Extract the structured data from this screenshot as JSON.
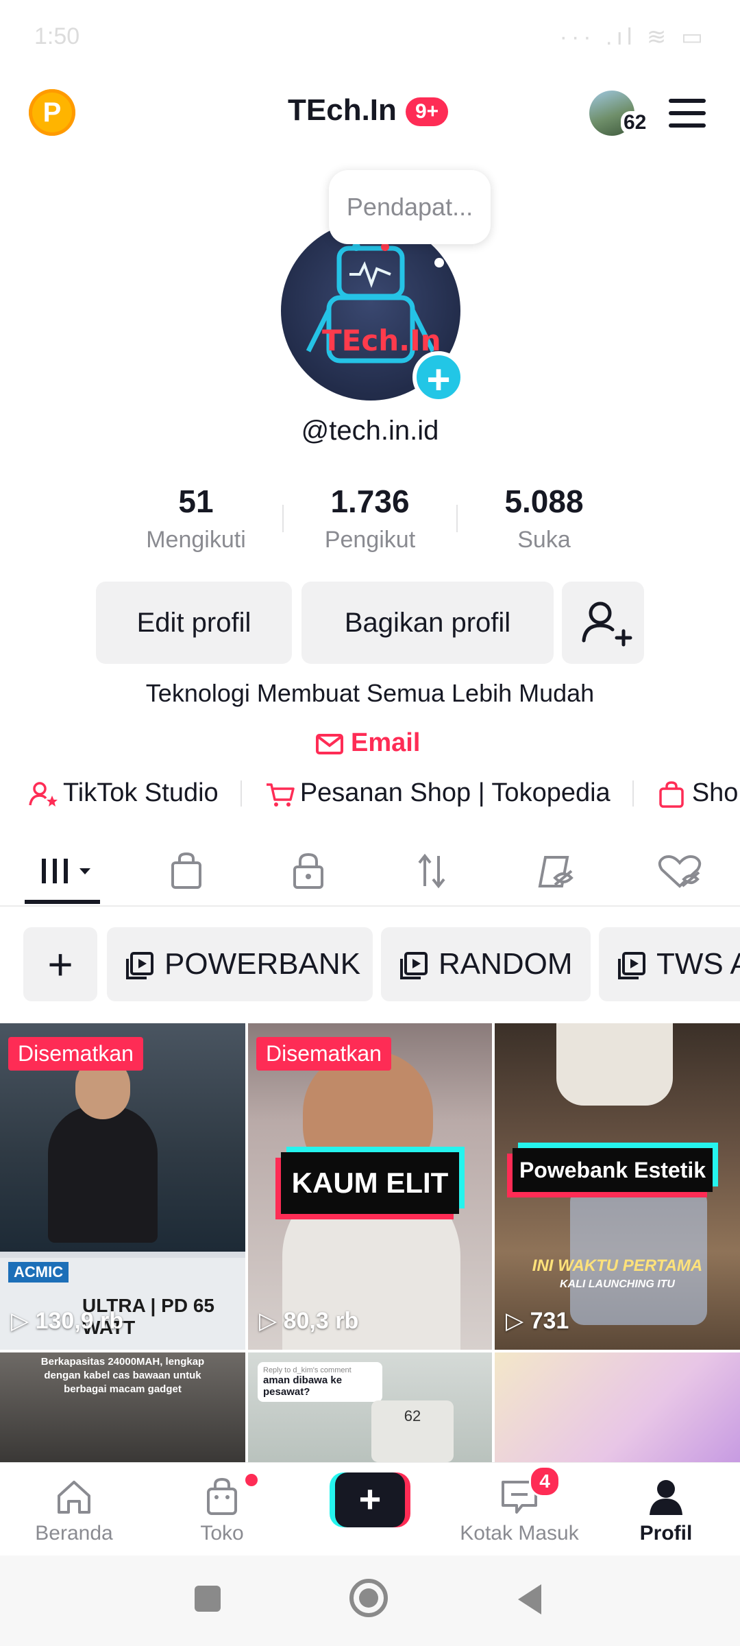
{
  "status_bar": {
    "time": "1:50",
    "icons": "··· .ıl ≋ ▭"
  },
  "header": {
    "title": "TEch.In",
    "notification_badge": "9+",
    "coin_letter": "P",
    "account_count": "62"
  },
  "profile": {
    "avatar_text": "TEch.In",
    "bubble_text": "Pendapat...",
    "username": "@tech.in.id",
    "stats": [
      {
        "value": "51",
        "label": "Mengikuti"
      },
      {
        "value": "1.736",
        "label": "Pengikut"
      },
      {
        "value": "5.088",
        "label": "Suka"
      }
    ],
    "buttons": {
      "edit": "Edit profil",
      "share": "Bagikan profil"
    },
    "bio": "Teknologi Membuat Semua Lebih Mudah",
    "email_label": "Email"
  },
  "links": [
    {
      "label": "TikTok Studio",
      "icon": "user-star-icon"
    },
    {
      "label": "Pesanan Shop | Tokopedia",
      "icon": "cart-icon"
    },
    {
      "label": "Sho",
      "icon": "shopping-bag-icon"
    }
  ],
  "tabs": [
    {
      "name": "videos",
      "icon": "grid-icon"
    },
    {
      "name": "shop",
      "icon": "shopping-bag-icon"
    },
    {
      "name": "private",
      "icon": "lock-icon"
    },
    {
      "name": "reposts",
      "icon": "repost-icon"
    },
    {
      "name": "saved",
      "icon": "hidden-bookmark-icon"
    },
    {
      "name": "liked",
      "icon": "hidden-heart-icon"
    }
  ],
  "collections": [
    "POWERBANK",
    "RANDOM",
    "TWS A"
  ],
  "videos": [
    {
      "pinned": "Disematkan",
      "views": "130,9 rb",
      "overlay": "ULTRA | PD 65 WATT",
      "brand": "ACMIC"
    },
    {
      "pinned": "Disematkan",
      "views": "80,3 rb",
      "overlay": "KAUM ELIT"
    },
    {
      "views": "731",
      "overlay": "Powebank Estetik",
      "caption": "INI WAKTU PERTAMA",
      "caption2": "KALI LAUNCHING ITU"
    },
    {
      "overlay": "Berkapasitas 24000MAH, lengkap dengan kabel cas bawaan untuk berbagai macam gadget"
    },
    {
      "reply_header": "Reply to d_kim's comment",
      "overlay": "aman dibawa ke pesawat?",
      "screen": "62"
    },
    {}
  ],
  "bottom_nav": [
    {
      "label": "Beranda",
      "icon": "home-icon"
    },
    {
      "label": "Toko",
      "icon": "shopping-bag-icon"
    },
    {
      "label": "",
      "icon": "create-plus-icon"
    },
    {
      "label": "Kotak Masuk",
      "icon": "inbox-icon",
      "badge": "4"
    },
    {
      "label": "Profil",
      "icon": "profile-icon"
    }
  ],
  "colors": {
    "accent": "#fe2c55",
    "cyan": "#25f4ee",
    "text": "#161823",
    "muted": "#8a8b91"
  }
}
